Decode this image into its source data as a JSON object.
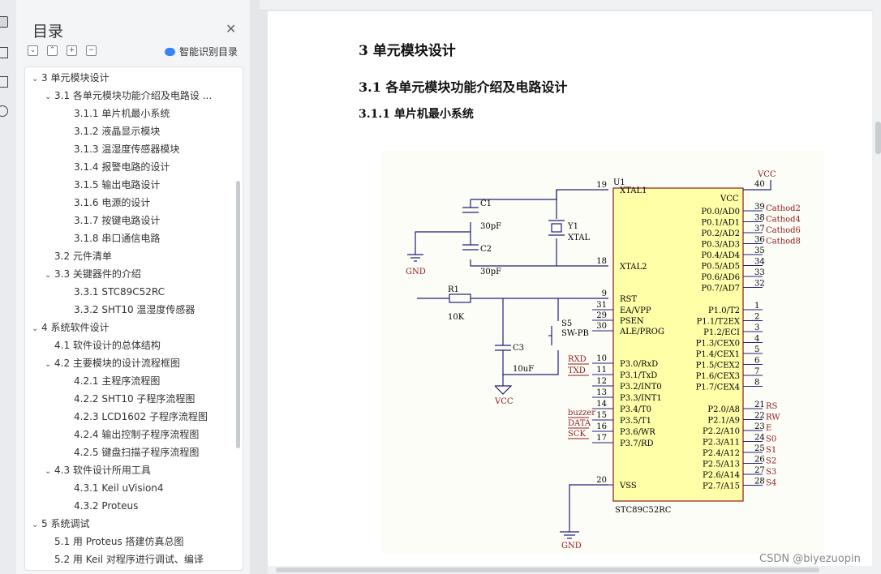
{
  "toc": {
    "title": "目录",
    "smart_label": "智能识别目录",
    "items": [
      {
        "label": "3  单元模块设计",
        "level": 0,
        "chev": "v"
      },
      {
        "label": "3.1  各单元模块功能介绍及电路设 ...",
        "level": 1,
        "chev": "v"
      },
      {
        "label": "3.1.1  单片机最小系统",
        "level": 2,
        "chev": ""
      },
      {
        "label": "3.1.2  液晶显示模块",
        "level": 2,
        "chev": ""
      },
      {
        "label": "3.1.3  温湿度传感器模块",
        "level": 2,
        "chev": ""
      },
      {
        "label": "3.1.4   报警电路的设计",
        "level": 2,
        "chev": ""
      },
      {
        "label": "3.1.5  输出电路设计",
        "level": 2,
        "chev": ""
      },
      {
        "label": "3.1.6  电源的设计",
        "level": 2,
        "chev": ""
      },
      {
        "label": "3.1.7   按键电路设计",
        "level": 2,
        "chev": ""
      },
      {
        "label": "3.1.8  串口通信电路",
        "level": 2,
        "chev": ""
      },
      {
        "label": "3.2  元件清单",
        "level": 1,
        "chev": ""
      },
      {
        "label": "3.3  关键器件的介绍",
        "level": 1,
        "chev": "v"
      },
      {
        "label": "3.3.1 STC89C52RC",
        "level": 2,
        "chev": ""
      },
      {
        "label": "3.3.2 SHT10 温湿度传感器",
        "level": 2,
        "chev": ""
      },
      {
        "label": "4  系统软件设计",
        "level": 0,
        "chev": "v"
      },
      {
        "label": "4.1  软件设计的总体结构",
        "level": 1,
        "chev": ""
      },
      {
        "label": "4.2  主要模块的设计流程框图",
        "level": 1,
        "chev": "v"
      },
      {
        "label": "4.2.1  主程序流程图",
        "level": 2,
        "chev": ""
      },
      {
        "label": "4.2.2 SHT10 子程序流程图",
        "level": 2,
        "chev": ""
      },
      {
        "label": "4.2.3 LCD1602 子程序流程图",
        "level": 2,
        "chev": ""
      },
      {
        "label": "4.2.4  输出控制子程序流程图",
        "level": 2,
        "chev": ""
      },
      {
        "label": "4.2.5  键盘扫描子程序流程图",
        "level": 2,
        "chev": ""
      },
      {
        "label": "4.3  软件设计所用工具",
        "level": 1,
        "chev": "v"
      },
      {
        "label": "4.3.1 Keil uVision4",
        "level": 2,
        "chev": ""
      },
      {
        "label": "4.3.2 Proteus",
        "level": 2,
        "chev": ""
      },
      {
        "label": "5  系统调试",
        "level": 0,
        "chev": "v"
      },
      {
        "label": "5.1  用 Proteus 搭建仿真总图",
        "level": 1,
        "chev": ""
      },
      {
        "label": "5.2  用 Keil 对程序进行调试、编译",
        "level": 1,
        "chev": ""
      }
    ]
  },
  "doc": {
    "heading1": "3  单元模块设计",
    "heading2": "3.1  各单元模块功能介绍及电路设计",
    "heading3": "3.1.1  单片机最小系统"
  },
  "schematic": {
    "u1": "U1",
    "chip": "STC89C52RC",
    "vcc": "VCC",
    "gnd": "GND",
    "c1": "C1",
    "c1v": "30pF",
    "c2": "C2",
    "c2v": "30pF",
    "y1": "Y1",
    "xtal": "XTAL",
    "r1": "R1",
    "r1v": "10K",
    "c3": "C3",
    "c3v": "10uF",
    "s5": "S5",
    "swpb": "SW-PB",
    "left_pins": [
      {
        "n": "19",
        "name": "XTAL1"
      },
      {
        "n": "18",
        "name": "XTAL2"
      },
      {
        "n": "9",
        "name": "RST"
      },
      {
        "n": "31",
        "name": "EA/VPP"
      },
      {
        "n": "29",
        "name": "PSEN"
      },
      {
        "n": "30",
        "name": "ALE/PROG"
      },
      {
        "n": "10",
        "name": "P3.0/RxD"
      },
      {
        "n": "11",
        "name": "P3.1/TxD"
      },
      {
        "n": "12",
        "name": "P3.2/INT0"
      },
      {
        "n": "13",
        "name": "P3.3/INT1"
      },
      {
        "n": "14",
        "name": "P3.4/T0"
      },
      {
        "n": "15",
        "name": "P3.5/T1"
      },
      {
        "n": "16",
        "name": "P3.6/WR"
      },
      {
        "n": "17",
        "name": "P3.7/RD"
      },
      {
        "n": "20",
        "name": "VSS"
      }
    ],
    "left_nets": [
      "RXD",
      "TXD",
      "buzzer",
      "DATA",
      "SCK"
    ],
    "right_pins_p0": [
      {
        "n": "39",
        "name": "P0.0/AD0",
        "net": "Cathod2"
      },
      {
        "n": "38",
        "name": "P0.1/AD1",
        "net": "Cathod4"
      },
      {
        "n": "37",
        "name": "P0.2/AD2",
        "net": "Cathod6"
      },
      {
        "n": "36",
        "name": "P0.3/AD3",
        "net": "Cathod8"
      },
      {
        "n": "35",
        "name": "P0.4/AD4",
        "net": ""
      },
      {
        "n": "34",
        "name": "P0.5/AD5",
        "net": ""
      },
      {
        "n": "33",
        "name": "P0.6/AD6",
        "net": ""
      },
      {
        "n": "32",
        "name": "P0.7/AD7",
        "net": ""
      }
    ],
    "right_pins_p1": [
      {
        "n": "1",
        "name": "P1.0/T2"
      },
      {
        "n": "2",
        "name": "P1.1/T2EX"
      },
      {
        "n": "3",
        "name": "P1.2/ECI"
      },
      {
        "n": "4",
        "name": "P1.3/CEX0"
      },
      {
        "n": "5",
        "name": "P1.4/CEX1"
      },
      {
        "n": "6",
        "name": "P1.5/CEX2"
      },
      {
        "n": "7",
        "name": "P1.6/CEX3"
      },
      {
        "n": "8",
        "name": "P1.7/CEX4"
      }
    ],
    "right_pins_p2": [
      {
        "n": "21",
        "name": "P2.0/A8",
        "net": "RS"
      },
      {
        "n": "22",
        "name": "P2.1/A9",
        "net": "RW"
      },
      {
        "n": "23",
        "name": "P2.2/A10",
        "net": "E"
      },
      {
        "n": "24",
        "name": "P2.3/A11",
        "net": "S0"
      },
      {
        "n": "25",
        "name": "P2.4/A12",
        "net": "S1"
      },
      {
        "n": "26",
        "name": "P2.5/A13",
        "net": "S2"
      },
      {
        "n": "27",
        "name": "P2.6/A14",
        "net": "S3"
      },
      {
        "n": "28",
        "name": "P2.7/A15",
        "net": "S4"
      }
    ],
    "vcc_pin": "40",
    "vcc_pin_name": "VCC",
    "vss_pin": "20"
  },
  "watermark": "CSDN @biyezuopin"
}
